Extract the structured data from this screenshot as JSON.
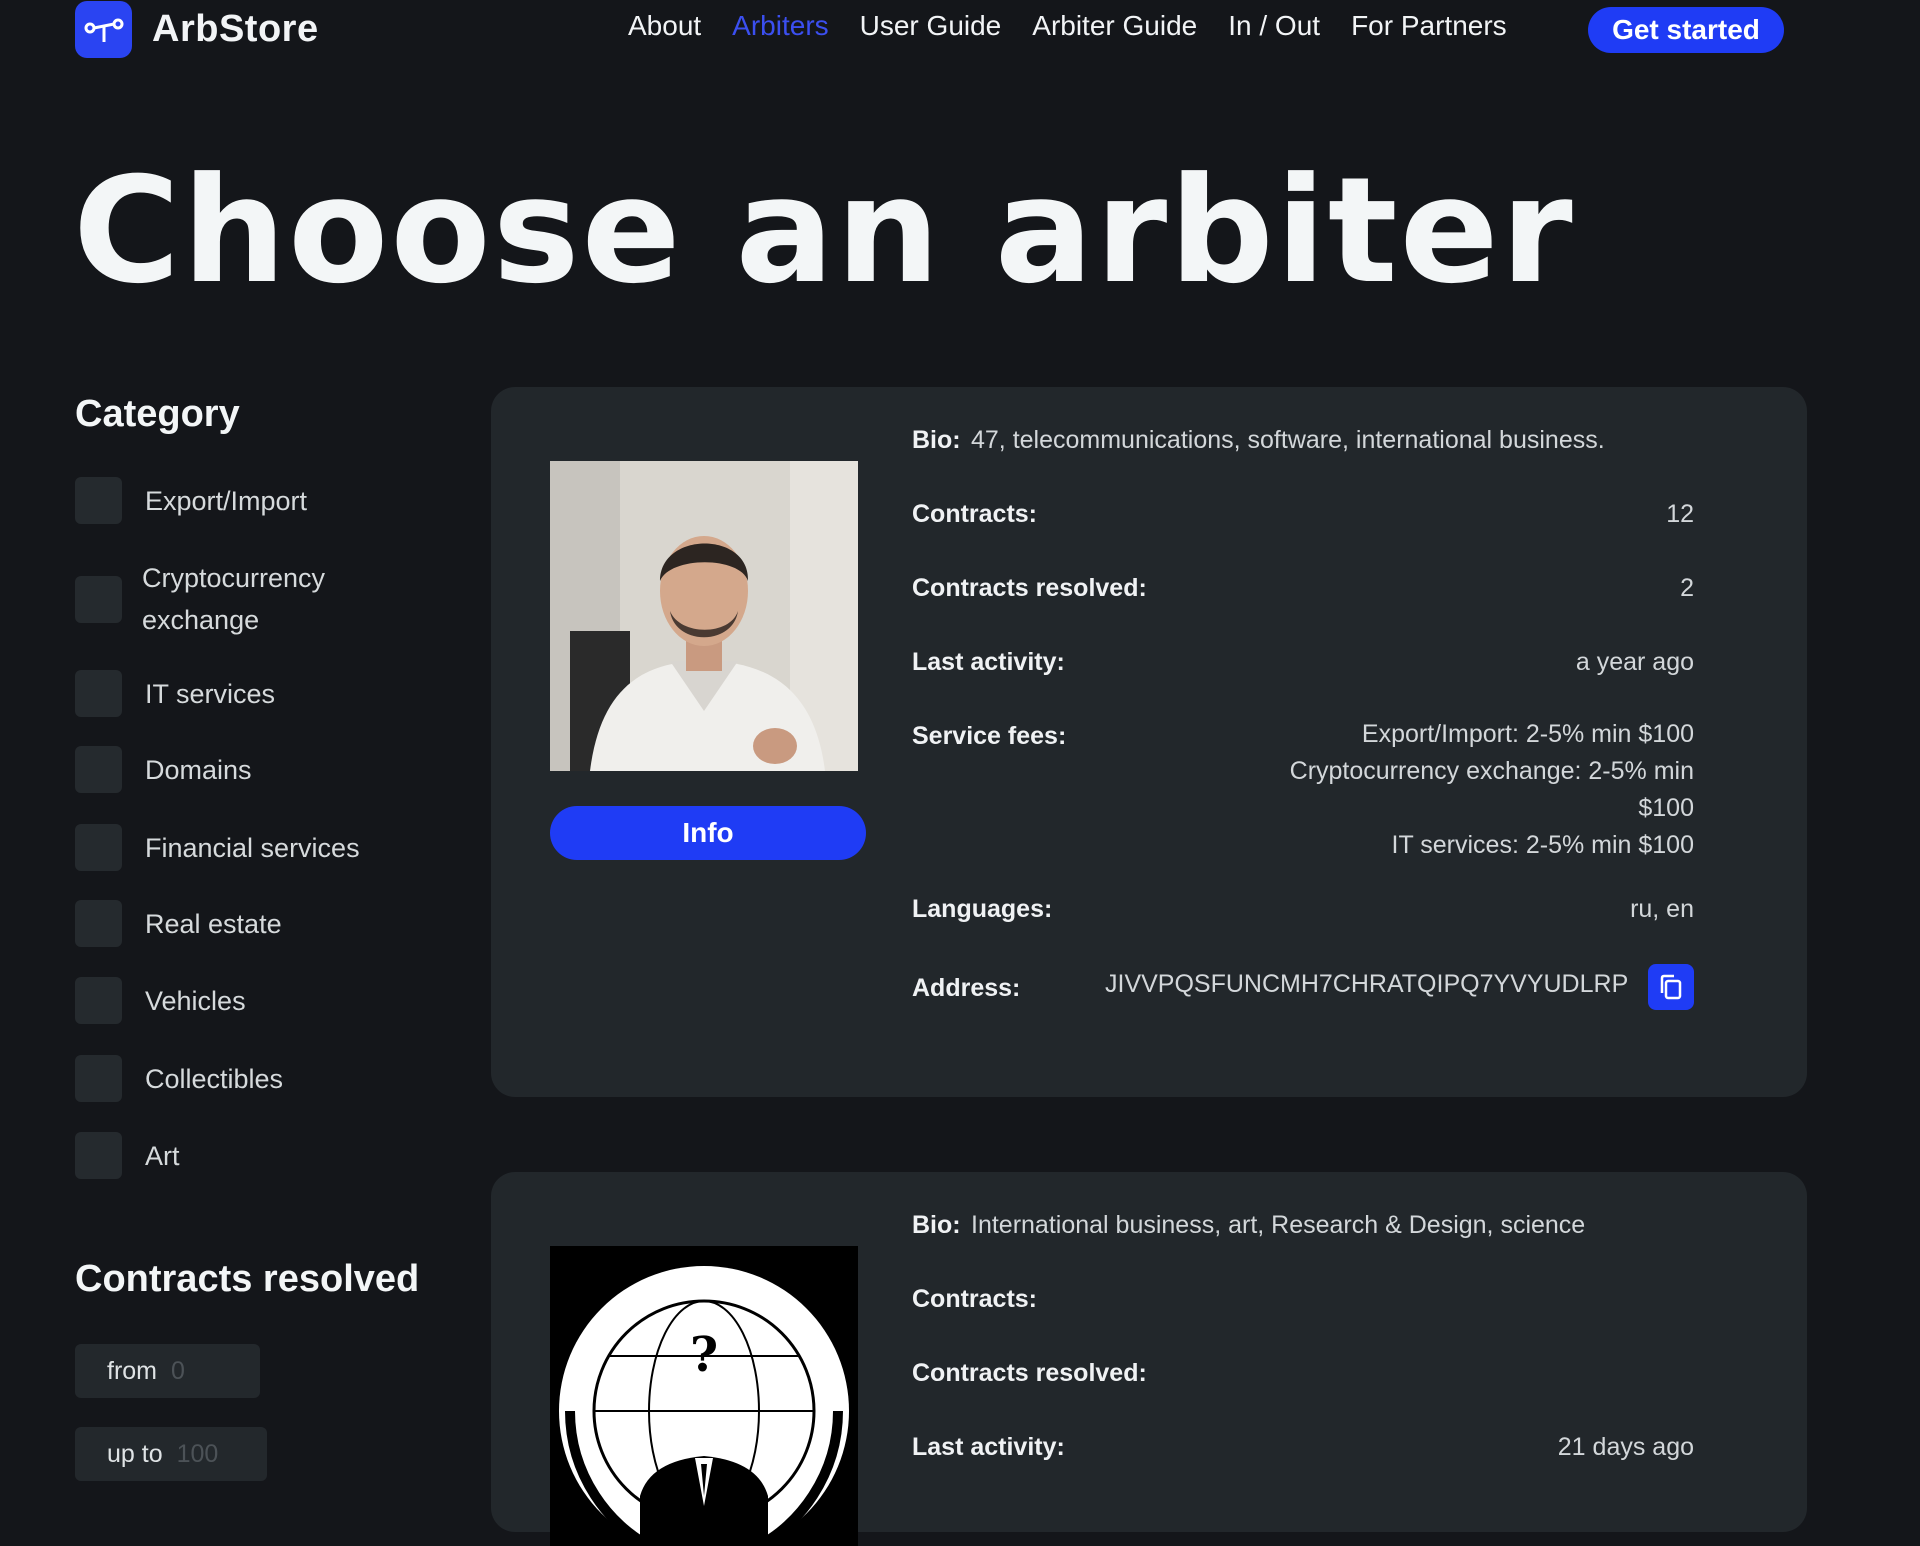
{
  "header": {
    "brand": "ArbStore",
    "nav": [
      "About",
      "Arbiters",
      "User Guide",
      "Arbiter Guide",
      "In / Out",
      "For Partners"
    ],
    "active_nav": "Arbiters",
    "cta": "Get started"
  },
  "page_title": "Choose an arbiter",
  "sidebar": {
    "category_title": "Category",
    "categories": [
      {
        "label": "Export/Import"
      },
      {
        "label": "Cryptocurrency exchange"
      },
      {
        "label": "IT services"
      },
      {
        "label": "Domains"
      },
      {
        "label": "Financial services"
      },
      {
        "label": "Real estate"
      },
      {
        "label": "Vehicles"
      },
      {
        "label": "Collectibles"
      },
      {
        "label": "Art"
      }
    ],
    "contracts_title": "Contracts resolved",
    "from_label": "from",
    "from_placeholder": "0",
    "to_label": "up to",
    "to_placeholder": "100"
  },
  "labels": {
    "bio": "Bio:",
    "contracts": "Contracts:",
    "resolved": "Contracts resolved:",
    "activity": "Last activity:",
    "fees": "Service fees:",
    "languages": "Languages:",
    "address": "Address:",
    "info": "Info"
  },
  "arbiters": [
    {
      "bio": "47, telecommunications, software, international business.",
      "contracts": "12",
      "resolved": "2",
      "last_activity": "a year ago",
      "fees": [
        "Export/Import: 2-5% min $100",
        "Cryptocurrency exchange: 2-5% min",
        "$100",
        "IT services: 2-5% min $100"
      ],
      "languages": "ru, en",
      "address": "JIVVPQSFUNCMH7CHRATQIPQ7YVYUDLRP"
    },
    {
      "bio": "International business, art, Research & Design, science",
      "contracts": "",
      "resolved": "",
      "last_activity": "21 days ago"
    }
  ],
  "colors": {
    "accent": "#1f3cf5",
    "background": "#14161a",
    "card": "#22272b"
  },
  "icons": [
    "logo-icon",
    "copy-icon",
    "checkbox"
  ]
}
